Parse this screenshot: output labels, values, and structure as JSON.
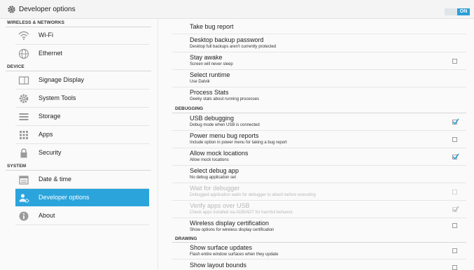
{
  "app": {
    "title": "Developer options",
    "master_toggle": "ON"
  },
  "sidebar": {
    "sections": [
      {
        "label": "WIRELESS & NETWORKS"
      },
      {
        "label": "DEVICE"
      },
      {
        "label": "SYSTEM"
      }
    ],
    "items": [
      {
        "label": "Wi-Fi",
        "icon": "wifi-icon"
      },
      {
        "label": "Ethernet",
        "icon": "ethernet-icon"
      },
      {
        "label": "Signage Display",
        "icon": "display-icon"
      },
      {
        "label": "System Tools",
        "icon": "gear-icon"
      },
      {
        "label": "Storage",
        "icon": "storage-icon"
      },
      {
        "label": "Apps",
        "icon": "apps-icon"
      },
      {
        "label": "Security",
        "icon": "lock-icon"
      },
      {
        "label": "Date & time",
        "icon": "calendar-icon"
      },
      {
        "label": "Developer options",
        "icon": "developer-icon",
        "selected": true
      },
      {
        "label": "About",
        "icon": "info-icon"
      }
    ]
  },
  "content": {
    "sections": [
      {
        "label": "DEBUGGING"
      },
      {
        "label": "DRAWING"
      }
    ],
    "rows": [
      {
        "title": "Take bug report",
        "summary": ""
      },
      {
        "title": "Desktop backup password",
        "summary": "Desktop full backups aren't currently protected"
      },
      {
        "title": "Stay awake",
        "summary": "Screen will never sleep",
        "checked": false
      },
      {
        "title": "Select runtime",
        "summary": "Use Dalvik"
      },
      {
        "title": "Process Stats",
        "summary": "Geeky stats about running processes"
      },
      {
        "title": "USB debugging",
        "summary": "Debug mode when USB is connected",
        "checked": true
      },
      {
        "title": "Power menu bug reports",
        "summary": "Include option in power menu for taking a bug report",
        "checked": false
      },
      {
        "title": "Allow mock locations",
        "summary": "Allow mock locations",
        "checked": true
      },
      {
        "title": "Select debug app",
        "summary": "No debug application set"
      },
      {
        "title": "Wait for debugger",
        "summary": "Debugged application waits for debugger to attach before executing",
        "checked": false,
        "disabled": true
      },
      {
        "title": "Verify apps over USB",
        "summary": "Check apps installed via ADB/ADT for harmful behavior.",
        "checked": true,
        "disabled": true
      },
      {
        "title": "Wireless display certification",
        "summary": "Show options for wireless display certification",
        "checked": false
      },
      {
        "title": "Show surface updates",
        "summary": "Flash entire window surfaces when they update",
        "checked": false
      },
      {
        "title": "Show layout bounds",
        "summary": "",
        "checked": false
      }
    ]
  },
  "colors": {
    "accent": "#2ba4dc",
    "toggle_on": "#2b9fd8"
  }
}
